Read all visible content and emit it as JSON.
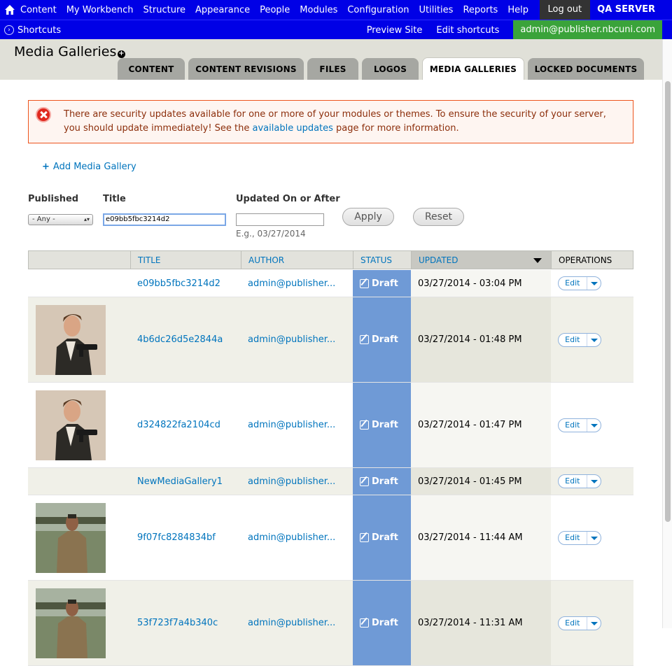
{
  "toolbar": {
    "menu": [
      "Content",
      "My Workbench",
      "Structure",
      "Appearance",
      "People",
      "Modules",
      "Configuration",
      "Utilities",
      "Reports",
      "Help"
    ],
    "logout": "Log out",
    "server": "QA SERVER",
    "shortcuts": "Shortcuts",
    "preview_site": "Preview Site",
    "edit_shortcuts": "Edit shortcuts",
    "user": "admin@publisher.nbcuni.com"
  },
  "page": {
    "title": "Media Galleries",
    "tabs": [
      "CONTENT",
      "CONTENT REVISIONS",
      "FILES",
      "LOGOS",
      "MEDIA GALLERIES",
      "LOCKED DOCUMENTS"
    ]
  },
  "alert": {
    "text_before": "There are security updates available for one or more of your modules or themes. To ensure the security of your server, you should update immediately! See the ",
    "link": "available updates",
    "text_after": " page for more information."
  },
  "add_link": "Add Media Gallery",
  "filters": {
    "published_label": "Published",
    "published_value": "- Any -",
    "title_label": "Title",
    "title_value": "e09bb5fbc3214d2",
    "updated_label": "Updated On or After",
    "updated_value": "",
    "updated_hint": "E.g., 03/27/2014",
    "apply": "Apply",
    "reset": "Reset"
  },
  "table": {
    "headers": [
      "TITLE",
      "AUTHOR",
      "STATUS",
      "UPDATED",
      "OPERATIONS"
    ],
    "edit_label": "Edit",
    "rows": [
      {
        "title": "e09bb5fbc3214d2",
        "author": "admin@publisher...",
        "status": "Draft",
        "updated": "03/27/2014 - 03:04 PM",
        "thumb": "none"
      },
      {
        "title": "4b6dc26d5e2844a",
        "author": "admin@publisher...",
        "status": "Draft",
        "updated": "03/27/2014 - 01:48 PM",
        "thumb": "portrait"
      },
      {
        "title": "d324822fa2104cd",
        "author": "admin@publisher...",
        "status": "Draft",
        "updated": "03/27/2014 - 01:47 PM",
        "thumb": "portrait"
      },
      {
        "title": "NewMediaGallery1",
        "author": "admin@publisher...",
        "status": "Draft",
        "updated": "03/27/2014 - 01:45 PM",
        "thumb": "none"
      },
      {
        "title": "9f07fc8284834bf",
        "author": "admin@publisher...",
        "status": "Draft",
        "updated": "03/27/2014 - 11:44 AM",
        "thumb": "soldier"
      },
      {
        "title": "53f723f7a4b340c",
        "author": "admin@publisher...",
        "status": "Draft",
        "updated": "03/27/2014 - 11:31 AM",
        "thumb": "soldier"
      }
    ]
  },
  "colors": {
    "toolbar": "#0000e6",
    "user_badge": "#3aa33a",
    "status_col": "#6f9ad6",
    "link": "#0074bd",
    "alert_border": "#ed541d"
  }
}
